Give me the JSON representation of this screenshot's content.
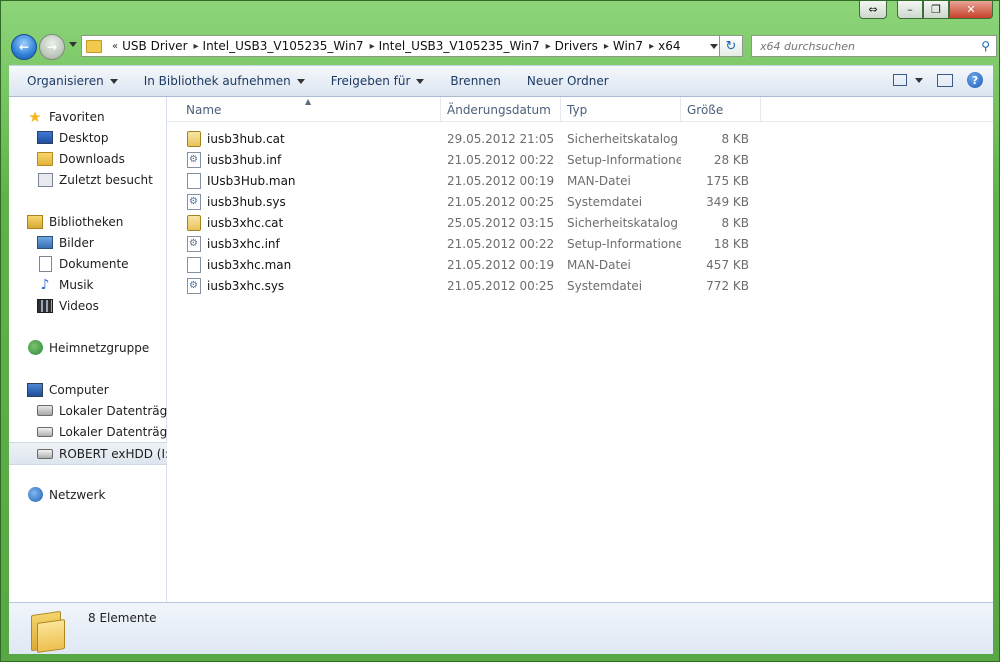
{
  "window": {
    "caption": {
      "restore_left": "⇔",
      "minimize": "–",
      "maximize": "❐",
      "close": "✕"
    }
  },
  "address_bar": {
    "overflow": "«",
    "separator": "▸",
    "crumbs": [
      "USB Driver",
      "Intel_USB3_V105235_Win7",
      "Intel_USB3_V105235_Win7",
      "Drivers",
      "Win7",
      "x64"
    ],
    "refresh_glyph": "↻"
  },
  "search": {
    "placeholder": "x64 durchsuchen",
    "glyph": "⚲"
  },
  "toolbar": {
    "organize": "Organisieren",
    "include_library": "In Bibliothek aufnehmen",
    "share": "Freigeben für",
    "burn": "Brennen",
    "new_folder": "Neuer Ordner",
    "help": "?"
  },
  "nav_pane": {
    "favorites": {
      "label": "Favoriten",
      "items": [
        "Desktop",
        "Downloads",
        "Zuletzt besucht"
      ]
    },
    "libraries": {
      "label": "Bibliotheken",
      "items": [
        "Bilder",
        "Dokumente",
        "Musik",
        "Videos"
      ]
    },
    "homegroup": {
      "label": "Heimnetzgruppe"
    },
    "computer": {
      "label": "Computer",
      "items": [
        "Lokaler Datenträger",
        "Lokaler Datenträger",
        "ROBERT exHDD (I:)"
      ]
    },
    "network": {
      "label": "Netzwerk"
    }
  },
  "columns": {
    "name": "Name",
    "date": "Änderungsdatum",
    "type": "Typ",
    "size": "Größe",
    "sort_glyph": "▲"
  },
  "files": [
    {
      "name": "iusb3hub.cat",
      "date": "29.05.2012 21:05",
      "type": "Sicherheitskatalog",
      "size": "8 KB",
      "icon": "certificate-icon"
    },
    {
      "name": "iusb3hub.inf",
      "date": "21.05.2012 00:22",
      "type": "Setup-Informationen",
      "size": "28 KB",
      "icon": "setup-info-icon"
    },
    {
      "name": "IUsb3Hub.man",
      "date": "21.05.2012 00:19",
      "type": "MAN-Datei",
      "size": "175 KB",
      "icon": "blank-file-icon"
    },
    {
      "name": "iusb3hub.sys",
      "date": "21.05.2012 00:25",
      "type": "Systemdatei",
      "size": "349 KB",
      "icon": "system-file-icon"
    },
    {
      "name": "iusb3xhc.cat",
      "date": "25.05.2012 03:15",
      "type": "Sicherheitskatalog",
      "size": "8 KB",
      "icon": "certificate-icon"
    },
    {
      "name": "iusb3xhc.inf",
      "date": "21.05.2012 00:22",
      "type": "Setup-Informationen",
      "size": "18 KB",
      "icon": "setup-info-icon"
    },
    {
      "name": "iusb3xhc.man",
      "date": "21.05.2012 00:19",
      "type": "MAN-Datei",
      "size": "457 KB",
      "icon": "blank-file-icon"
    },
    {
      "name": "iusb3xhc.sys",
      "date": "21.05.2012 00:25",
      "type": "Systemdatei",
      "size": "772 KB",
      "icon": "system-file-icon"
    }
  ],
  "details": {
    "count": "8 Elemente"
  },
  "colors": {
    "frame": "#5fb24a",
    "toolbar": "#e8eef6",
    "text_muted": "#6d6d6d",
    "header_text": "#4c607a"
  }
}
